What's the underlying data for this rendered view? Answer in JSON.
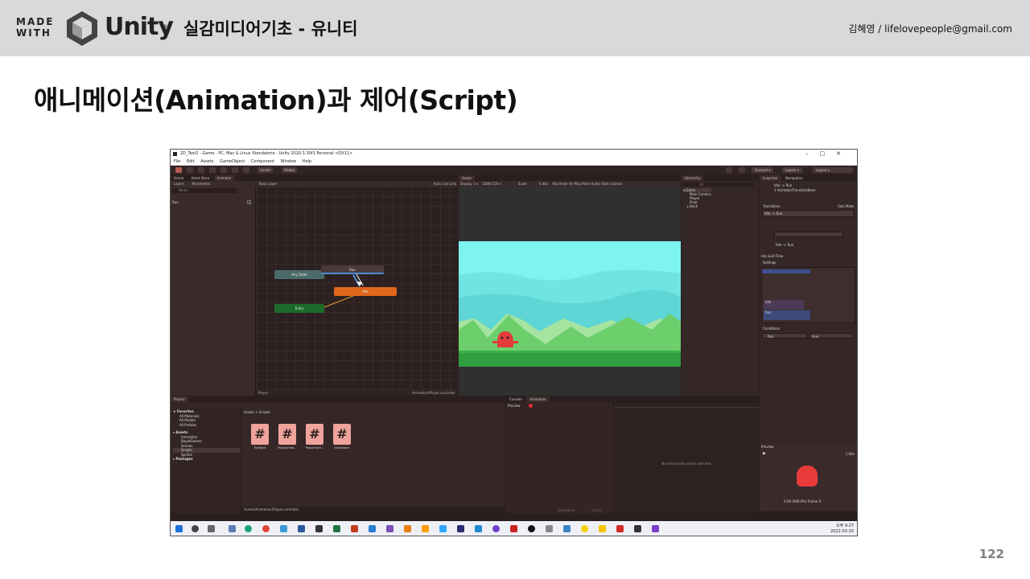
{
  "header": {
    "made_with": "MADE WITH",
    "brand": "Unity",
    "trademark": "®",
    "course_title": "실감미디어기초 - 유니티",
    "author": "김혜영 / lifelovepeople@gmail.com"
  },
  "slide": {
    "title": "애니메이션(Animation)과 제어(Script)",
    "page_number": "122"
  },
  "unity": {
    "window_title": "2D_Test2 - Game - PC, Mac & Linux Standalone - Unity 2020.3.30f1 Personal <DX11>",
    "window_controls": [
      "–",
      "□",
      "✕"
    ],
    "menu": [
      "File",
      "Edit",
      "Assets",
      "GameObject",
      "Component",
      "Window",
      "Help"
    ],
    "toolbar": {
      "pivot": "Center",
      "space": "Global",
      "account": "Account ▾",
      "layers": "Layers ▾",
      "layout": "Layout ▾"
    },
    "animator": {
      "tabs": [
        "Scene",
        "Asset Store",
        "Animator"
      ],
      "sub_tabs": [
        "Layers",
        "Parameters"
      ],
      "layer": "Base Layer",
      "auto_live": "Auto Live Link",
      "search_placeholder": "Name",
      "param_name": "Run",
      "param_value": "✓",
      "states": {
        "any": "Any State",
        "run": "Run",
        "idle": "Idle",
        "entry": "Entry"
      },
      "footer_left": "Player",
      "footer_right": "Animation/Player.controller"
    },
    "game": {
      "tab": "Game",
      "display": "Display 1 ▾",
      "resolution": "1280x720 ▾",
      "scale_label": "Scale",
      "scale_value": "0.48x",
      "options": "Maximize On Play   Mute Audio   Stats   Gizmos"
    },
    "hierarchy": {
      "tab": "Hierarchy",
      "search": "All",
      "items": [
        "▾ Game",
        "Main Camera",
        "Player",
        "Floor",
        "▸ Back"
      ]
    },
    "inspector": {
      "tabs": [
        "Inspector",
        "Navigation"
      ],
      "transition_name": "Idle -> Run",
      "transition_type": "1 AnimatorTransitionBase",
      "transitions_label": "Transitions",
      "solo_mute": "Solo  Mute",
      "transition_row": "Idle -> Run",
      "has_exit": "Has Exit Time",
      "settings": "Settings",
      "timeline_idle": "Idle",
      "timeline_run": "Run",
      "conditions": "Conditions",
      "cond_param": "Run",
      "cond_value": "true",
      "preview_label": "Preview",
      "preview_speed": "1.00x",
      "preview_frame": "0:00 (000.0%) Frame 0"
    },
    "project": {
      "tab": "Project",
      "tree": [
        "★ Favorites",
        "All Materials",
        "All Models",
        "All Prefabs",
        "▾ Assets",
        "Animation",
        "BayatGames",
        "Scenes",
        "Scripts",
        "Sprites",
        "▸ Packages"
      ],
      "breadcrumb": "Assets > Scripts",
      "scripts": [
        "MyMove",
        "PlayControl...",
        "PlayerCont...",
        "StartGame"
      ],
      "footer": "Assets/Animation/Player.controller"
    },
    "animation": {
      "tabs": [
        "Console",
        "Animation"
      ],
      "preview": "Preview",
      "empty_message": "No animatable object selected.",
      "footer_left": "Dopesheet",
      "footer_right": "Curves"
    },
    "clock": {
      "time": "오후 9:27",
      "date": "2022-03-20"
    }
  }
}
